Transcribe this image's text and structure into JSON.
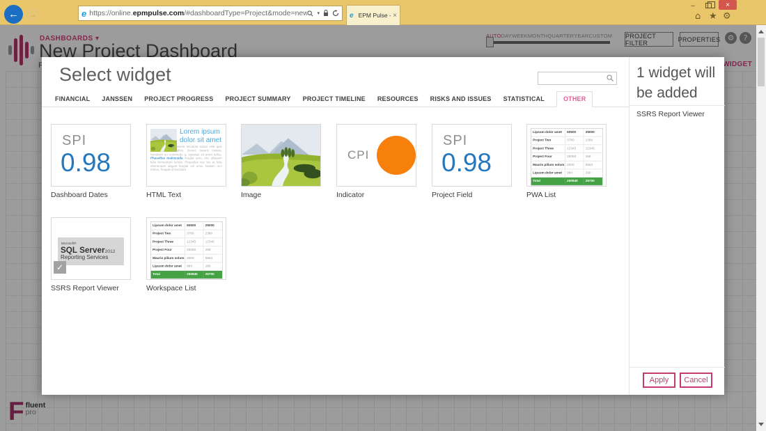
{
  "colors": {
    "accent": "#d6417f",
    "blue": "#2678be",
    "orange": "#f77f0c",
    "green": "#44a244",
    "chrome": "#eac66b"
  },
  "icons": {
    "back": "←",
    "forward": "→",
    "minimize": "–",
    "close": "×",
    "tab_close": "×",
    "home": "⌂",
    "favorites": "★",
    "tools": "⚙",
    "dropdown": "▾",
    "settings_gear": "⚙",
    "help": "?",
    "check": "✓",
    "caret": "▾"
  },
  "browser": {
    "url_prefix": "https://online.",
    "url_domain": "epmpulse.com",
    "url_suffix": "/#dashboardType=Project&mode=new",
    "tab_title": "EPM Pulse - New Project D..."
  },
  "page": {
    "nav_label": "DASHBOARDS",
    "title": "New Project Dashboard",
    "partial_label": "P",
    "time_ranges": [
      "AUTO",
      "DAY",
      "WEEK",
      "MONTH",
      "QUARTER",
      "YEAR",
      "CUSTOM"
    ],
    "active_range": "AUTO",
    "project_filter_label": "PROJECT FILTER",
    "properties_label": "PROPERTIES",
    "add_widget_label": "ADD WIDGET",
    "brand": {
      "bold": "fluent",
      "light": "pro",
      "letter": "F"
    }
  },
  "modal": {
    "title": "Select widget",
    "search_placeholder": "",
    "tabs": [
      "FINANCIAL",
      "JANSSEN",
      "PROJECT PROGRESS",
      "PROJECT SUMMARY",
      "PROJECT TIMELINE",
      "RESOURCES",
      "RISKS AND ISSUES",
      "STATISTICAL",
      "OTHER"
    ],
    "active_tab": "OTHER",
    "widgets": [
      {
        "name": "Dashboard Dates",
        "metric": "SPI",
        "value": "0.98"
      },
      {
        "name": "HTML Text",
        "heading": "Lorem ipsum dolor sit amet",
        "body_1": "Praesent tincidunt luctus velit quis dapibus. Donec mauris massa, hendrerit eu commodo a, egestas sit amet tellus. ",
        "link": "Phasellus malesuada",
        "body_2": " feugiat arcu, nec aliquam felis fermentum luctus. Phasellus nec leo at felis elementum aliquet feugiat vel urna. Nullam orci metus, feugiat id tincidunt"
      },
      {
        "name": "Image"
      },
      {
        "name": "Indicator",
        "metric": "CPI"
      },
      {
        "name": "Project Field",
        "metric": "SPI",
        "value": "0.98"
      },
      {
        "name": "PWA List"
      },
      {
        "name": "SSRS Report Viewer",
        "selected": true
      },
      {
        "name": "Workspace List"
      }
    ],
    "table_preview": {
      "rows": [
        [
          "Lipsum dolor amet",
          "60500",
          "25000"
        ],
        [
          "Project Two",
          "3780",
          "2380"
        ],
        [
          "Project Three",
          "12345",
          "12345"
        ],
        [
          "Project Four",
          "28350",
          "268"
        ],
        [
          "Mauris pilium solum",
          "2500",
          "5563"
        ],
        [
          "Lipsum dolor amet",
          "984",
          "290"
        ]
      ],
      "total": [
        "Total",
        "250840",
        "25700"
      ]
    },
    "ssrs_logo": {
      "brand": "Microsoft®",
      "product": "SQL Server",
      "year": "2012",
      "sub": "Reporting Services"
    },
    "summary": {
      "heading": "1 widget will be added",
      "item": "SSRS Report Viewer"
    },
    "apply_label": "Apply",
    "cancel_label": "Cancel"
  }
}
